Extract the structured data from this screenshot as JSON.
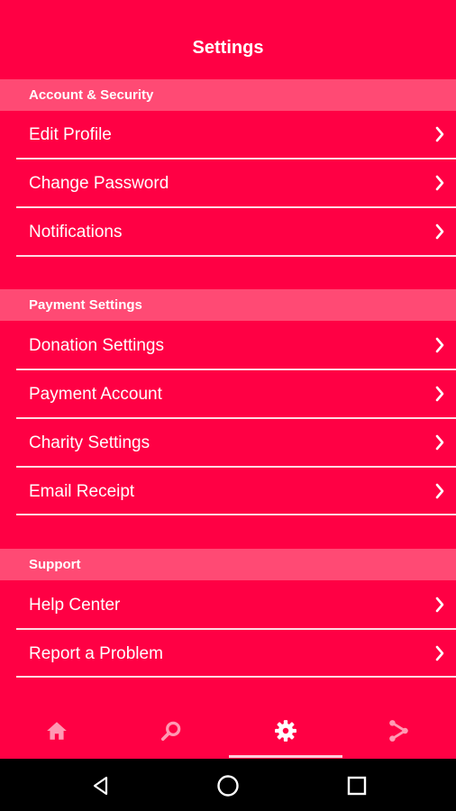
{
  "header": {
    "title": "Settings"
  },
  "sections": {
    "account": {
      "title": "Account & Security",
      "items": [
        "Edit Profile",
        "Change Password",
        "Notifications"
      ]
    },
    "payment": {
      "title": "Payment Settings",
      "items": [
        "Donation Settings",
        "Payment Account",
        "Charity Settings",
        "Email Receipt"
      ]
    },
    "support": {
      "title": "Support",
      "items": [
        "Help Center",
        "Report a Problem"
      ]
    }
  },
  "tabs": [
    {
      "icon": "home-icon",
      "active": false
    },
    {
      "icon": "search-icon",
      "active": false
    },
    {
      "icon": "gear-icon",
      "active": true
    },
    {
      "icon": "share-icon",
      "active": false
    }
  ],
  "system_nav": [
    "back-icon",
    "home-circle-icon",
    "recents-icon"
  ],
  "colors": {
    "background": "#ff0044",
    "section_bar": "#ff4a74",
    "text": "#ffffff",
    "inactive_icon": "#ff99b3",
    "nav_bar": "#000000"
  }
}
